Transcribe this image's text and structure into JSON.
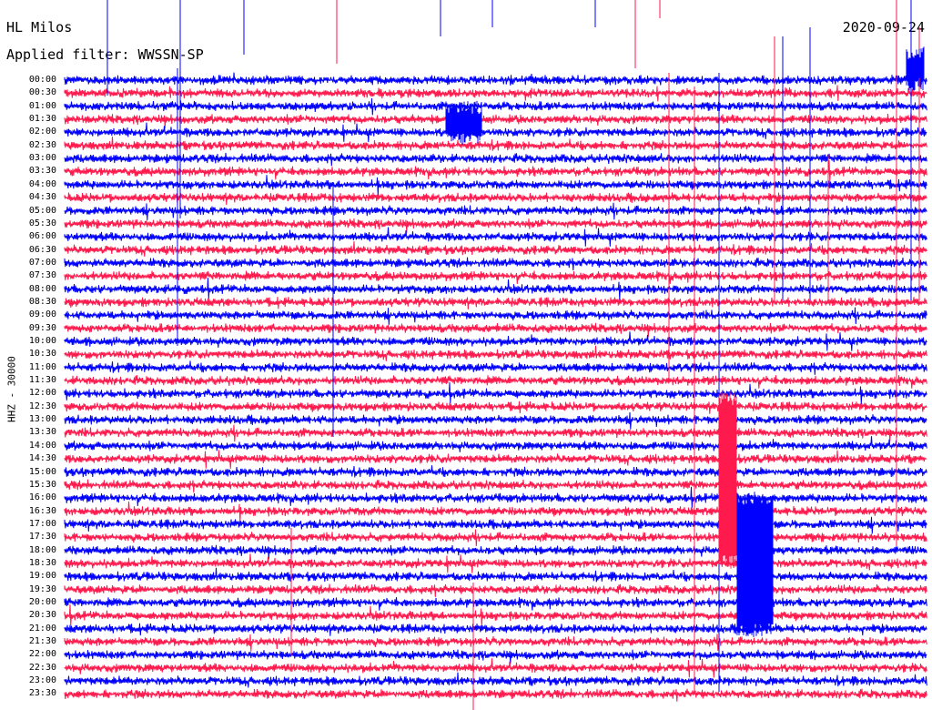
{
  "header": {
    "station": "HL Milos",
    "filter": "Applied filter: WWSSN-SP",
    "date": "2020-09-24"
  },
  "axis": {
    "channel_label": "HHZ - 30000"
  },
  "colors": {
    "trace_a": "#0000ff",
    "trace_b": "#ff1a4d",
    "background": "#ffffff"
  },
  "chart_data": {
    "type": "line",
    "title": "HL Milos",
    "subtitle": "Applied filter: WWSSN-SP",
    "ylabel": "HHZ - 30000",
    "rows": [
      "00:00",
      "00:30",
      "01:00",
      "01:30",
      "02:00",
      "02:30",
      "03:00",
      "03:30",
      "04:00",
      "04:30",
      "05:00",
      "05:30",
      "06:00",
      "06:30",
      "07:00",
      "07:30",
      "08:00",
      "08:30",
      "09:00",
      "09:30",
      "10:00",
      "10:30",
      "11:00",
      "11:30",
      "12:00",
      "12:30",
      "13:00",
      "13:30",
      "14:00",
      "14:30",
      "15:00",
      "15:30",
      "16:00",
      "16:30",
      "17:00",
      "17:30",
      "18:00",
      "18:30",
      "19:00",
      "19:30",
      "20:00",
      "20:30",
      "21:00",
      "21:30",
      "22:00",
      "22:30",
      "23:00",
      "23:30"
    ],
    "row_duration_minutes": 30,
    "series": [
      {
        "color": "#0000ff",
        "rows": "even"
      },
      {
        "color": "#ff1a4d",
        "rows": "odd"
      }
    ],
    "grid": false
  }
}
